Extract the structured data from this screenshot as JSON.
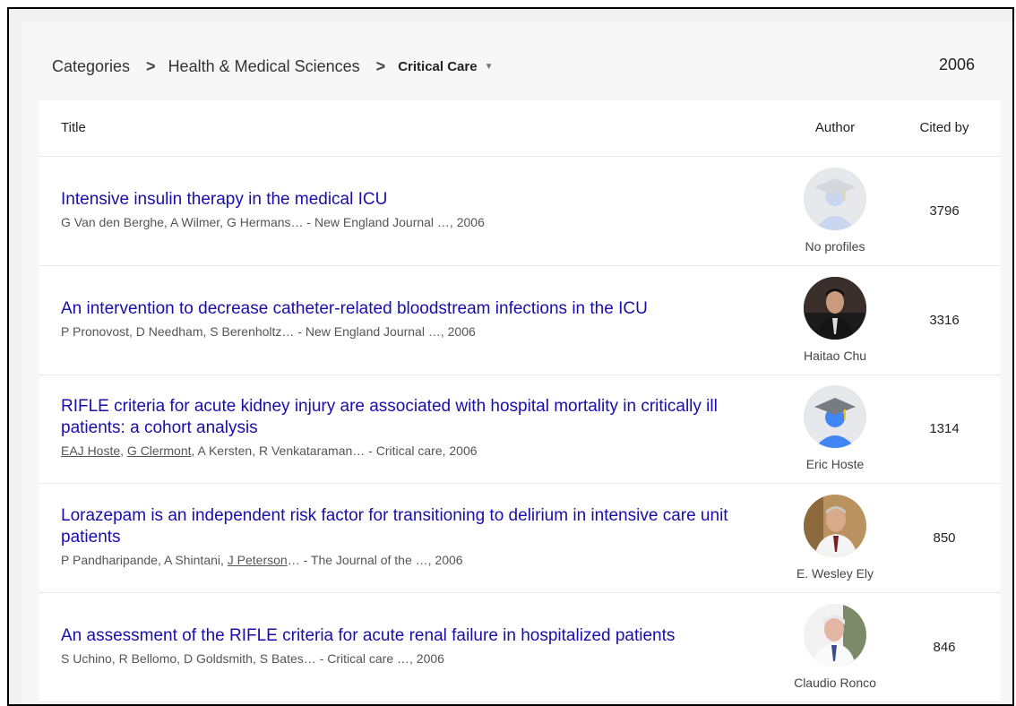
{
  "breadcrumb": {
    "items": [
      "Categories",
      "Health & Medical Sciences"
    ],
    "separator": ">",
    "current": "Critical Care",
    "year": "2006"
  },
  "table": {
    "headers": {
      "title": "Title",
      "author": "Author",
      "cited_by": "Cited by"
    },
    "rows": [
      {
        "title": "Intensive insulin therapy in the medical ICU",
        "meta": "G Van den Berghe, A Wilmer, G Hermans… - New England Journal …, 2006",
        "author": "No profiles",
        "avatar": "default-graduate-avatar-faded",
        "cited": "3796"
      },
      {
        "title": "An intervention to decrease catheter-related bloodstream infections in the ICU",
        "meta": "P Pronovost, D Needham, S Berenholtz… - New England Journal …, 2006",
        "author": "Haitao Chu",
        "avatar": "photo",
        "cited": "3316"
      },
      {
        "title": "RIFLE criteria for acute kidney injury are associated with hospital mortality in critically ill patients: a cohort analysis",
        "meta_linked": [
          "EAJ Hoste",
          "G Clermont"
        ],
        "meta_rest": ", A Kersten, R Venkataraman… - Critical care, 2006",
        "author": "Eric Hoste",
        "avatar": "default-graduate-avatar",
        "cited": "1314"
      },
      {
        "title": "Lorazepam is an independent risk factor for transitioning to delirium in intensive care unit patients",
        "meta_pre": "P Pandharipande, A Shintani, ",
        "meta_linked": "J Peterson",
        "meta_post": "… - The Journal of the …, 2006",
        "author": "E. Wesley Ely",
        "avatar": "photo",
        "cited": "850"
      },
      {
        "title": "An assessment of the RIFLE criteria for acute renal failure in hospitalized patients",
        "meta": "S Uchino, R Bellomo, D Goldsmith, S Bates… - Critical care …, 2006",
        "author": "Claudio Ronco",
        "avatar": "photo",
        "cited": "846"
      }
    ]
  },
  "colors": {
    "link": "#1a0dab",
    "accent_blue": "#4285f4"
  }
}
